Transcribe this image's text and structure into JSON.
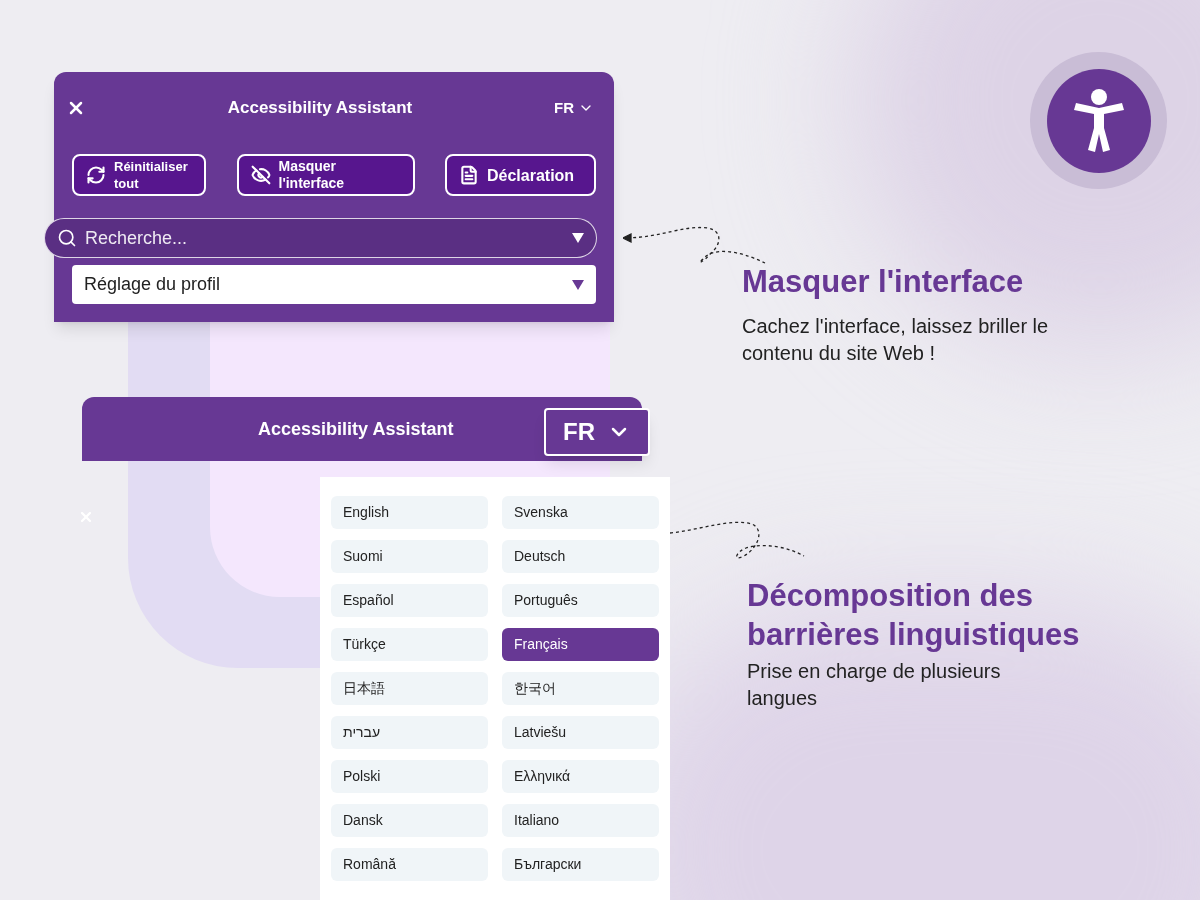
{
  "panel": {
    "title": "Accessibility Assistant",
    "language": "FR",
    "buttons": [
      {
        "kind": "reset",
        "label": "Réinitialiser tout"
      },
      {
        "kind": "hide",
        "label": "Masquer l'interface"
      },
      {
        "kind": "statement",
        "label": "Déclaration"
      }
    ],
    "search": {
      "placeholder": "Recherche..."
    },
    "profile_select": {
      "value": "Réglage du profil"
    }
  },
  "language_panel": {
    "title": "Accessibility Assistant",
    "language": "FR",
    "languages": [
      {
        "label": "English",
        "selected": false
      },
      {
        "label": "Svenska",
        "selected": false
      },
      {
        "label": "Suomi",
        "selected": false
      },
      {
        "label": "Deutsch",
        "selected": false
      },
      {
        "label": "Español",
        "selected": false
      },
      {
        "label": "Português",
        "selected": false
      },
      {
        "label": "Türkçe",
        "selected": false
      },
      {
        "label": "Français",
        "selected": true
      },
      {
        "label": "日本語",
        "selected": false
      },
      {
        "label": "한국어",
        "selected": false
      },
      {
        "label": "עברית",
        "selected": false
      },
      {
        "label": "Latviešu",
        "selected": false
      },
      {
        "label": "Polski",
        "selected": false
      },
      {
        "label": "Ελληνικά",
        "selected": false
      },
      {
        "label": "Dansk",
        "selected": false
      },
      {
        "label": "Italiano",
        "selected": false
      },
      {
        "label": "Română",
        "selected": false
      },
      {
        "label": "Български",
        "selected": false
      }
    ]
  },
  "features": [
    {
      "title": "Masquer l'interface",
      "text": "Cachez l'interface, laissez briller le contenu du site Web !"
    },
    {
      "title": "Décomposition des barrières linguistiques",
      "text": "Prise en charge de plusieurs langues"
    }
  ]
}
